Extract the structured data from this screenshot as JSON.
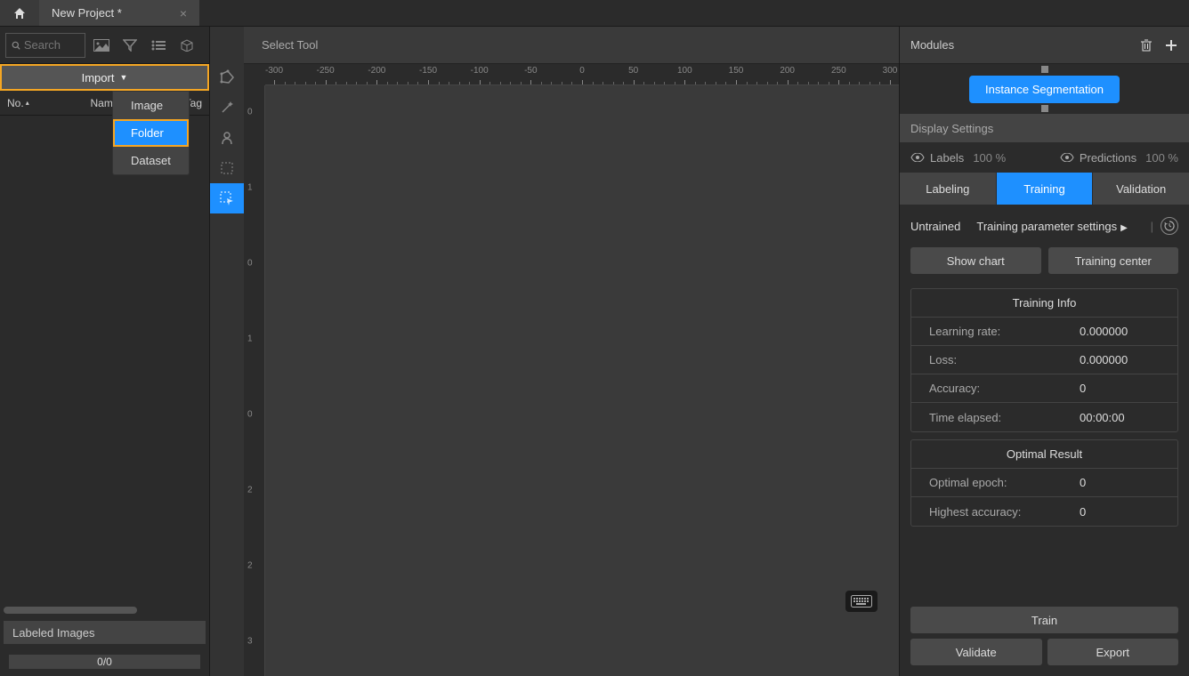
{
  "titlebar": {
    "tab_title": "New Project *"
  },
  "left": {
    "search_placeholder": "Search",
    "import_label": "Import",
    "import_menu": {
      "image": "Image",
      "folder": "Folder",
      "dataset": "Dataset"
    },
    "cols": {
      "no": "No.",
      "name": "Name",
      "tag": "Tag"
    },
    "labeled_images": "Labeled Images",
    "progress": "0/0"
  },
  "canvas": {
    "title": "Select Tool",
    "ruler_h": [
      "-300",
      "-250",
      "-200",
      "-150",
      "-100",
      "-50",
      "0",
      "50",
      "100",
      "150",
      "200",
      "250",
      "300"
    ],
    "ruler_v": [
      "0",
      "1",
      "0",
      "1",
      "0",
      "2",
      "2",
      "3"
    ]
  },
  "right": {
    "modules_title": "Modules",
    "module_name": "Instance Segmentation",
    "display_settings": "Display Settings",
    "vis": {
      "labels": "Labels",
      "labels_pct": "100 %",
      "predictions": "Predictions",
      "predictions_pct": "100 %"
    },
    "tabs": {
      "labeling": "Labeling",
      "training": "Training",
      "validation": "Validation"
    },
    "status": "Untrained",
    "param_settings": "Training parameter settings",
    "show_chart": "Show chart",
    "training_center": "Training center",
    "training_info": {
      "title": "Training Info",
      "learning_rate_k": "Learning rate:",
      "learning_rate_v": "0.000000",
      "loss_k": "Loss:",
      "loss_v": "0.000000",
      "accuracy_k": "Accuracy:",
      "accuracy_v": "0",
      "time_k": "Time elapsed:",
      "time_v": "00:00:00"
    },
    "optimal": {
      "title": "Optimal Result",
      "epoch_k": "Optimal epoch:",
      "epoch_v": "0",
      "acc_k": "Highest accuracy:",
      "acc_v": "0"
    },
    "train_btn": "Train",
    "validate_btn": "Validate",
    "export_btn": "Export"
  }
}
